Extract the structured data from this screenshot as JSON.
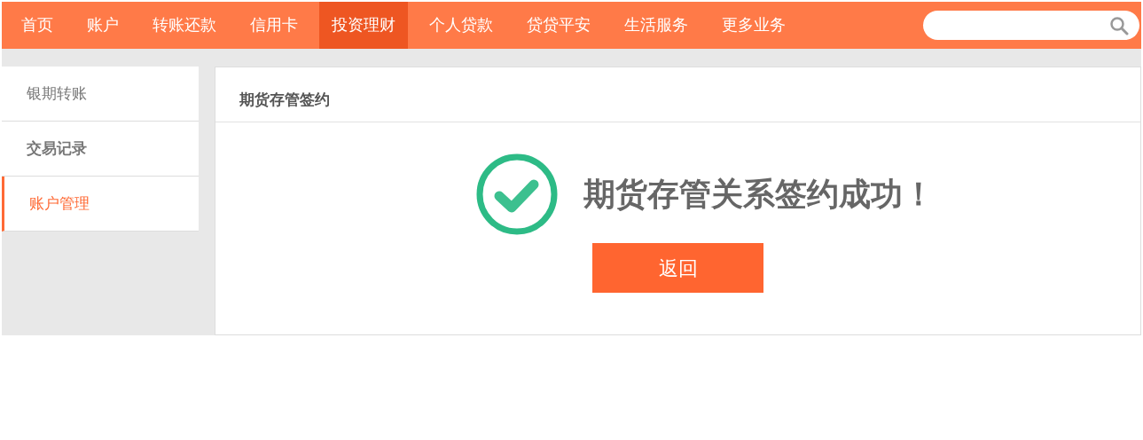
{
  "nav": {
    "items": [
      {
        "label": "首页",
        "selected": false
      },
      {
        "label": "账户",
        "selected": false
      },
      {
        "label": "转账还款",
        "selected": false
      },
      {
        "label": "信用卡",
        "selected": false
      },
      {
        "label": "投资理财",
        "selected": true
      },
      {
        "label": "个人贷款",
        "selected": false
      },
      {
        "label": "贷贷平安",
        "selected": false
      },
      {
        "label": "生活服务",
        "selected": false
      },
      {
        "label": "更多业务",
        "selected": false
      }
    ]
  },
  "sidebar": {
    "items": [
      {
        "label": "银期转账",
        "selected": false,
        "emphasized": false
      },
      {
        "label": "交易记录",
        "selected": false,
        "emphasized": true
      },
      {
        "label": "账户管理",
        "selected": true,
        "emphasized": false
      }
    ]
  },
  "panel": {
    "title": "期货存管签约",
    "message": "期货存管关系签约成功！",
    "button": "返回"
  }
}
